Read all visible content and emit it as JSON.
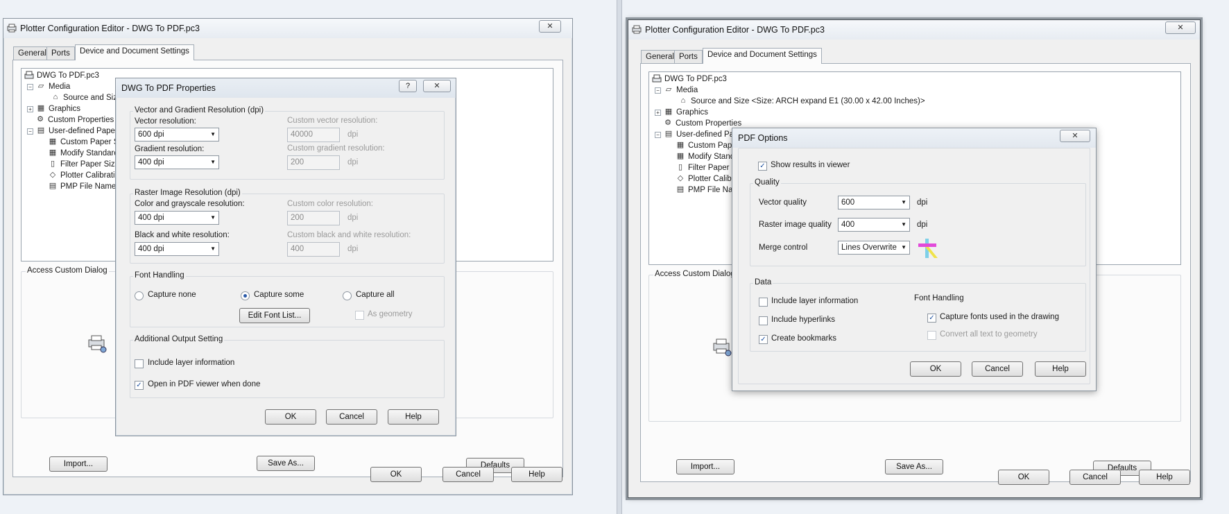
{
  "left": {
    "window_title": "Plotter Configuration Editor - DWG To PDF.pc3",
    "close_glyph": "✕",
    "tabs": [
      "General",
      "Ports",
      "Device and Document Settings"
    ],
    "tree": {
      "root": "DWG To PDF.pc3",
      "media": "Media",
      "source_size": "Source and Size",
      "graphics": "Graphics",
      "custom_properties": "Custom Properties",
      "user_defined": "User-defined Paper",
      "custom_paper": "Custom Paper S",
      "modify_standard": "Modify Standard",
      "filter_paper": "Filter Paper Size",
      "plotter_calibration": "Plotter Calibratio",
      "pmp_file": "PMP File Name"
    },
    "access_custom_dialog": "Access Custom Dialog",
    "buttons": {
      "import": "Import...",
      "save_as": "Save As...",
      "defaults": "Defaults",
      "ok": "OK",
      "cancel": "Cancel",
      "help": "Help"
    }
  },
  "props_dialog": {
    "title": "DWG To PDF Properties",
    "help_glyph": "?",
    "close_glyph": "✕",
    "vector_group": "Vector and Gradient Resolution (dpi)",
    "vector_resolution_label": "Vector resolution:",
    "vector_resolution_value": "600 dpi",
    "custom_vector_label": "Custom vector resolution:",
    "custom_vector_value": "40000",
    "gradient_label": "Gradient resolution:",
    "gradient_value": "400 dpi",
    "custom_gradient_label": "Custom gradient resolution:",
    "custom_gradient_value": "200",
    "raster_group": "Raster Image Resolution (dpi)",
    "color_label": "Color and grayscale resolution:",
    "color_value": "400 dpi",
    "custom_color_label": "Custom color resolution:",
    "custom_color_value": "200",
    "bw_label": "Black and white resolution:",
    "bw_value": "400 dpi",
    "custom_bw_label": "Custom black and white resolution:",
    "custom_bw_value": "400",
    "dpi": "dpi",
    "font_group": "Font Handling",
    "capture_none": "Capture none",
    "capture_some": "Capture some",
    "capture_all": "Capture all",
    "edit_font_list": "Edit Font List...",
    "as_geometry": "As geometry",
    "additional_group": "Additional Output Setting",
    "include_layer": "Include layer information",
    "open_pdf": "Open in PDF viewer when done",
    "check_mark": "✓",
    "ok": "OK",
    "cancel": "Cancel",
    "help": "Help"
  },
  "right": {
    "window_title": "Plotter Configuration Editor - DWG To PDF.pc3",
    "close_glyph": "✕",
    "tabs": [
      "General",
      "Ports",
      "Device and Document Settings"
    ],
    "tree": {
      "root": "DWG To PDF.pc3",
      "media": "Media",
      "source_size": "Source and Size <Size: ARCH expand E1 (30.00 x 42.00 Inches)>",
      "graphics": "Graphics",
      "custom_properties": "Custom Properties",
      "user_defined": "User-defined Pa",
      "custom_paper": "Custom Pap",
      "modify_standard": "Modify Stand",
      "filter_paper": "Filter Paper",
      "plotter_calibration": "Plotter Calib",
      "pmp_file": "PMP File Na"
    },
    "access_custom_dialog": "Access Custom Dialog",
    "buttons": {
      "import": "Import...",
      "save_as": "Save As...",
      "defaults": "Defaults",
      "ok": "OK",
      "cancel": "Cancel",
      "help": "Help"
    }
  },
  "pdf_options": {
    "title": "PDF Options",
    "close_glyph": "✕",
    "show_results": "Show results in viewer",
    "quality_group": "Quality",
    "vector_quality_label": "Vector quality",
    "vector_quality_value": "600",
    "raster_quality_label": "Raster image quality",
    "raster_quality_value": "400",
    "dpi": "dpi",
    "merge_label": "Merge control",
    "merge_value": "Lines Overwrite",
    "data_group": "Data",
    "include_layer": "Include layer information",
    "include_hyperlinks": "Include hyperlinks",
    "create_bookmarks": "Create bookmarks",
    "font_handling": "Font Handling",
    "capture_fonts": "Capture fonts used in the drawing",
    "convert_text": "Convert all text to geometry",
    "check_mark": "✓",
    "ok": "OK",
    "cancel": "Cancel",
    "help": "Help"
  },
  "colors": {
    "window_bg": "#f0f0f0",
    "panel_bg": "#fbfbfb",
    "check": "#1b4f9e",
    "border": "#8a949e"
  }
}
